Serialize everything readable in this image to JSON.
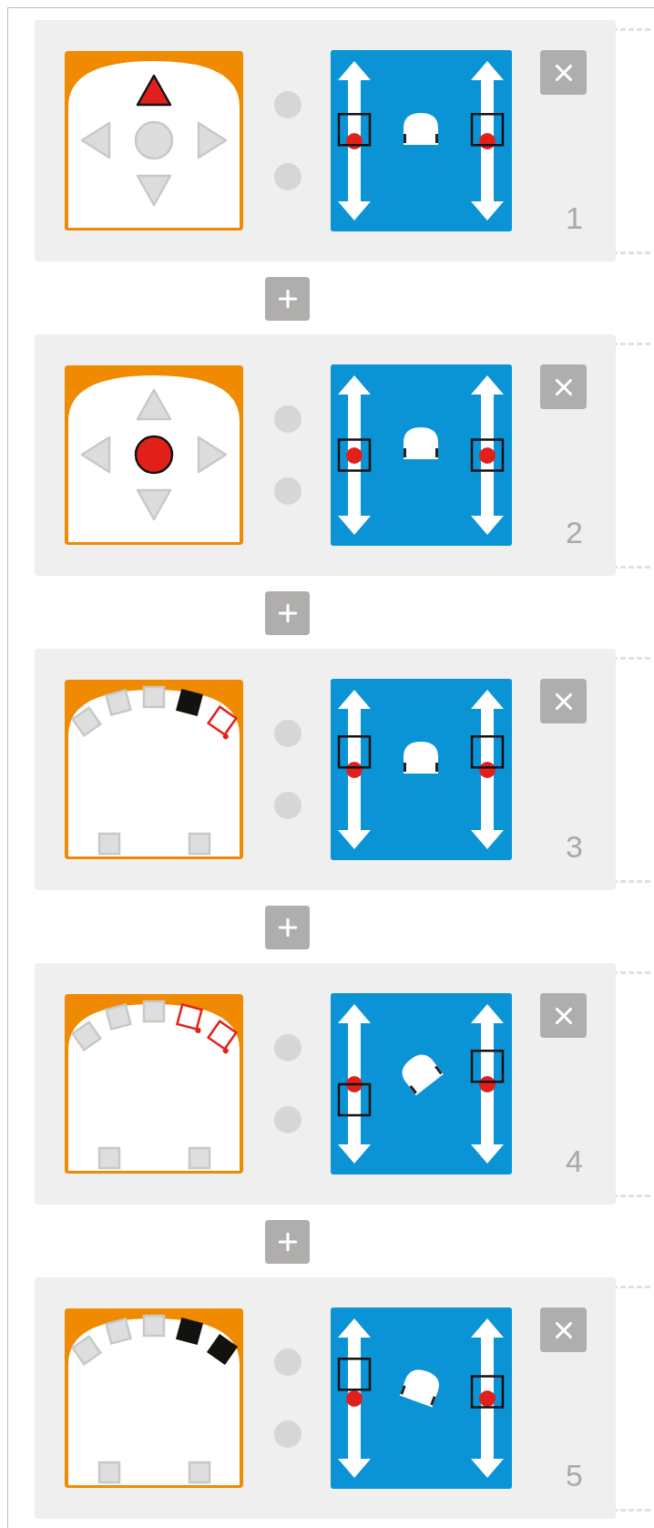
{
  "rules": [
    {
      "number": "1",
      "event": {
        "kind": "buttons",
        "buttons": [
          {
            "selected": true
          },
          {
            "selected": false
          },
          {
            "selected": false
          },
          {
            "selected": false
          },
          {
            "selected": false
          }
        ]
      },
      "motors": [
        {
          "level": 0.57
        },
        {
          "level": 0.57
        }
      ]
    },
    {
      "number": "2",
      "event": {
        "kind": "buttons",
        "buttons": [
          {
            "selected": false
          },
          {
            "selected": false
          },
          {
            "selected": true
          },
          {
            "selected": false
          },
          {
            "selected": false
          }
        ]
      },
      "motors": [
        {
          "level": 0.5
        },
        {
          "level": 0.5
        }
      ]
    },
    {
      "number": "3",
      "event": {
        "kind": "proximity",
        "sensors": [
          {
            "kind": "off"
          },
          {
            "kind": "off"
          },
          {
            "kind": "off"
          },
          {
            "kind": "black"
          },
          {
            "kind": "red"
          },
          {
            "kind": "off"
          },
          {
            "kind": "off"
          }
        ]
      },
      "motors": [
        {
          "level": 0.61
        },
        {
          "level": 0.61
        }
      ]
    },
    {
      "number": "4",
      "event": {
        "kind": "proximity",
        "sensors": [
          {
            "kind": "off"
          },
          {
            "kind": "off"
          },
          {
            "kind": "off"
          },
          {
            "kind": "red"
          },
          {
            "kind": "red"
          },
          {
            "kind": "off"
          },
          {
            "kind": "off"
          }
        ]
      },
      "motors": [
        {
          "level": 0.4
        },
        {
          "level": 0.61
        }
      ]
    },
    {
      "number": "5",
      "event": {
        "kind": "proximity",
        "sensors": [
          {
            "kind": "off"
          },
          {
            "kind": "off"
          },
          {
            "kind": "off"
          },
          {
            "kind": "black"
          },
          {
            "kind": "black"
          },
          {
            "kind": "off"
          },
          {
            "kind": "off"
          }
        ]
      },
      "motors": [
        {
          "level": 0.65
        },
        {
          "level": 0.54
        }
      ]
    }
  ]
}
